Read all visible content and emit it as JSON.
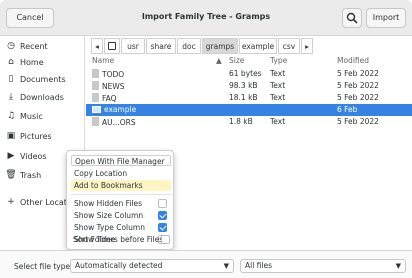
{
  "header": {
    "cancel_label": "Cancel",
    "title": "Import Family Tree - Gramps",
    "import_label": "Import"
  },
  "sidebar": {
    "items": [
      {
        "label": "Recent",
        "icon": "clock-icon"
      },
      {
        "label": "Home",
        "icon": "home-icon"
      },
      {
        "label": "Documents",
        "icon": "document-icon"
      },
      {
        "label": "Downloads",
        "icon": "download-icon"
      },
      {
        "label": "Music",
        "icon": "music-icon"
      },
      {
        "label": "Pictures",
        "icon": "picture-icon"
      },
      {
        "label": "Videos",
        "icon": "video-icon"
      },
      {
        "label": "Trash",
        "icon": "trash-icon"
      },
      {
        "label": "Other Locat",
        "icon": "plus-icon"
      }
    ]
  },
  "path": {
    "crumbs": [
      "usr",
      "share",
      "doc",
      "gramps",
      "example",
      "csv"
    ],
    "active_crumb": "gramps"
  },
  "columns": {
    "name": "Name",
    "size": "Size",
    "type": "Type",
    "modified": "Modified"
  },
  "files": [
    {
      "name": "TODO",
      "size": "61 bytes",
      "type": "Text",
      "modified": "5 Feb 2022",
      "kind": "file"
    },
    {
      "name": "NEWS",
      "size": "98.3 kB",
      "type": "Text",
      "modified": "5 Feb 2022",
      "kind": "file"
    },
    {
      "name": "FAQ",
      "size": "18.1 kB",
      "type": "Text",
      "modified": "5 Feb 2022",
      "kind": "file"
    },
    {
      "name": "example",
      "size": "",
      "type": "",
      "modified": "6 Feb",
      "kind": "folder"
    },
    {
      "name": "AU...ORS",
      "size": "1.8 kB",
      "type": "Text",
      "modified": "5 Feb 2022",
      "kind": "file"
    }
  ],
  "context_menu": {
    "open_with": "Open With File Manager",
    "copy_location": "Copy Location",
    "add_bookmarks": "Add to Bookmarks",
    "show_hidden": "Show Hidden Files",
    "show_size": "Show Size Column",
    "show_type": "Show Type Column",
    "show_time": "Show Time",
    "sort_folders": "Sort Folders before Files"
  },
  "footer": {
    "filetype_label": "Select file type:",
    "filetype_value": "Automatically detected",
    "filter_value": "All files"
  }
}
